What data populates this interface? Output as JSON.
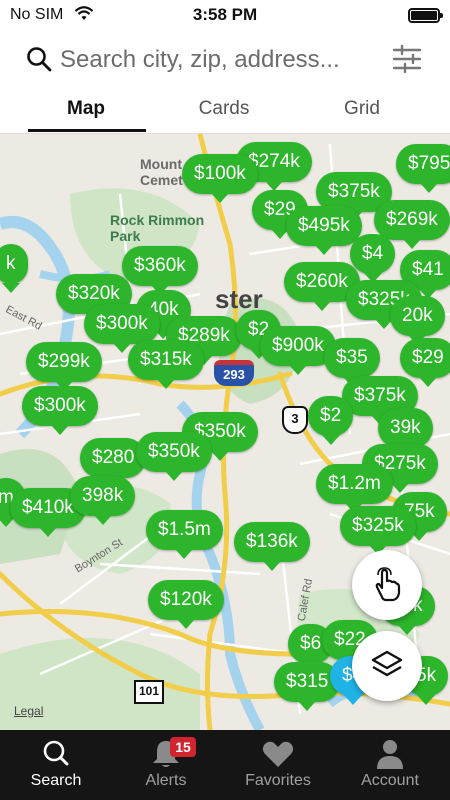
{
  "status_bar": {
    "carrier": "No SIM",
    "time": "3:58 PM"
  },
  "search": {
    "placeholder": "Search city, zip, address..."
  },
  "tabs": [
    {
      "label": "Map",
      "active": true
    },
    {
      "label": "Cards",
      "active": false
    },
    {
      "label": "Grid",
      "active": false
    }
  ],
  "map": {
    "labels": {
      "mount_cemetery": "Mount\nCemet",
      "rock_rimmon_park": "Rock Rimmon\nPark",
      "city": "ster",
      "east_rd": "East Rd",
      "boynton_st": "Boynton St",
      "calef_rd": "Calef Rd",
      "legal": "Legal"
    },
    "shields": {
      "i293": "293",
      "nh3": "3",
      "nh101": "101"
    },
    "pins": [
      {
        "price": "$274k"
      },
      {
        "price": "$795"
      },
      {
        "price": "$100k"
      },
      {
        "price": "$375k"
      },
      {
        "price": "$29"
      },
      {
        "price": "$495k"
      },
      {
        "price": "$269k"
      },
      {
        "price": "$4"
      },
      {
        "price": "$360k"
      },
      {
        "price": "$41"
      },
      {
        "price": "k"
      },
      {
        "price": "$260k"
      },
      {
        "price": "$320k"
      },
      {
        "price": "$325k"
      },
      {
        "price": "40k"
      },
      {
        "price": "$300k"
      },
      {
        "price": "20k"
      },
      {
        "price": "$289k"
      },
      {
        "price": "$2"
      },
      {
        "price": "$900k"
      },
      {
        "price": "$299k"
      },
      {
        "price": "$35"
      },
      {
        "price": "$29"
      },
      {
        "price": "$315k"
      },
      {
        "price": "$375k"
      },
      {
        "price": "$300k"
      },
      {
        "price": "$2"
      },
      {
        "price": "39k"
      },
      {
        "price": "$350k"
      },
      {
        "price": "$280"
      },
      {
        "price": "$350k"
      },
      {
        "price": "$275k"
      },
      {
        "price": "$1.2m"
      },
      {
        "price": "m"
      },
      {
        "price": "$410k"
      },
      {
        "price": "398k"
      },
      {
        "price": "75k"
      },
      {
        "price": "$325k"
      },
      {
        "price": "$1.5m"
      },
      {
        "price": "$136k"
      },
      {
        "price": "$120k"
      },
      {
        "price": "20k"
      },
      {
        "price": "$6"
      },
      {
        "price": "$22"
      },
      {
        "price": "$315"
      },
      {
        "price": "5k"
      },
      {
        "price": "$4"
      }
    ]
  },
  "bottom_nav": [
    {
      "label": "Search",
      "active": true
    },
    {
      "label": "Alerts",
      "badge": "15"
    },
    {
      "label": "Favorites"
    },
    {
      "label": "Account"
    }
  ],
  "colors": {
    "pin_green": "#2db52b",
    "pin_blue": "#1fb3e6",
    "nav_background": "#151515",
    "badge_red": "#d0242e"
  }
}
